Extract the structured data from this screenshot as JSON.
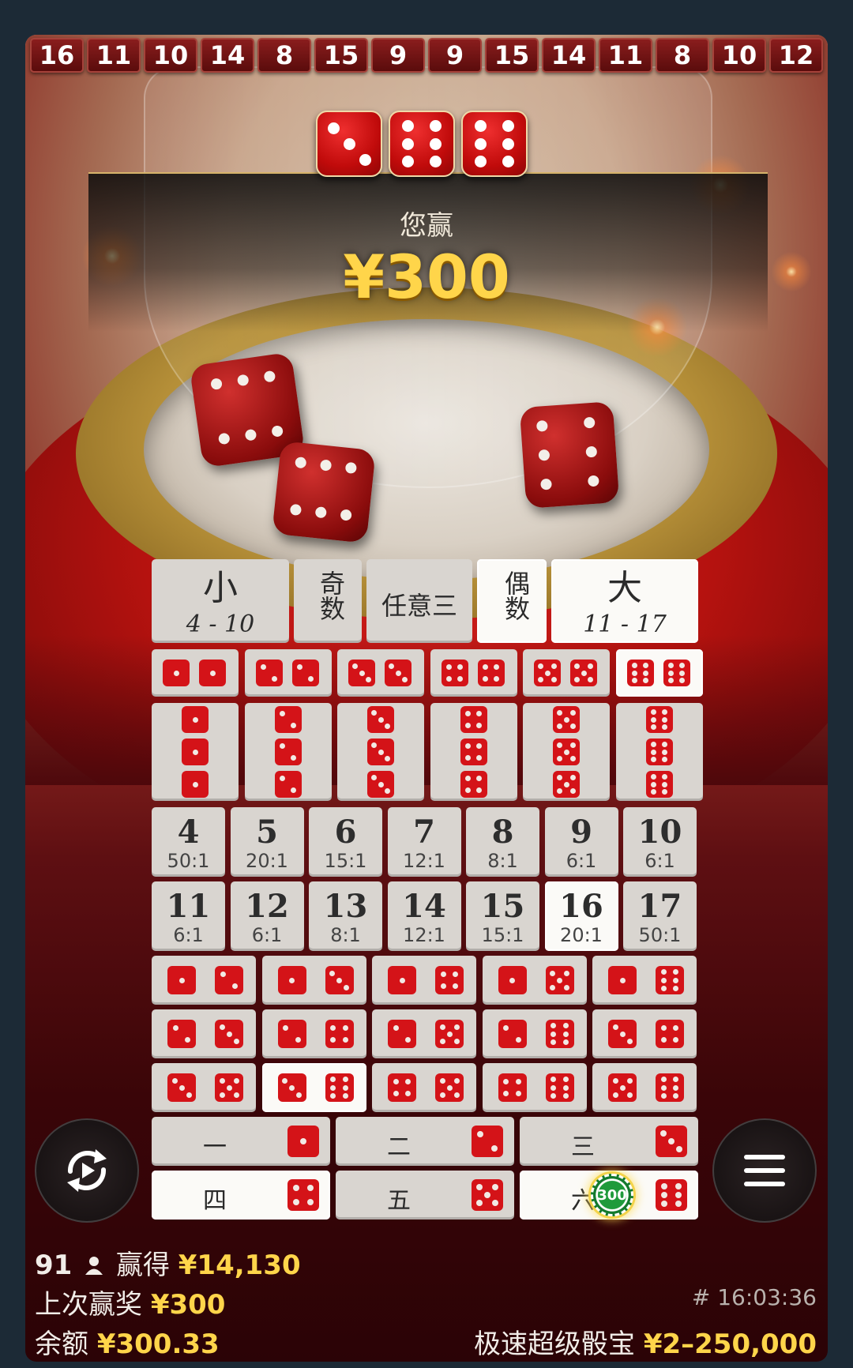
{
  "history": [
    "16",
    "11",
    "10",
    "14",
    "8",
    "15",
    "9",
    "9",
    "15",
    "14",
    "11",
    "8",
    "10",
    "12"
  ],
  "result": {
    "dice": [
      3,
      6,
      6
    ],
    "win_label": "您赢",
    "win_amount": "¥300"
  },
  "bets": {
    "small": {
      "label": "小",
      "range": "4 - 10"
    },
    "odd": "奇数",
    "any_triple": "任意三",
    "even": "偶数",
    "big": {
      "label": "大",
      "range": "11 - 17"
    },
    "totals": [
      {
        "n": "4",
        "odds": "50:1"
      },
      {
        "n": "5",
        "odds": "20:1"
      },
      {
        "n": "6",
        "odds": "15:1"
      },
      {
        "n": "7",
        "odds": "12:1"
      },
      {
        "n": "8",
        "odds": "8:1"
      },
      {
        "n": "9",
        "odds": "6:1"
      },
      {
        "n": "10",
        "odds": "6:1"
      },
      {
        "n": "11",
        "odds": "6:1"
      },
      {
        "n": "12",
        "odds": "6:1"
      },
      {
        "n": "13",
        "odds": "8:1"
      },
      {
        "n": "14",
        "odds": "12:1"
      },
      {
        "n": "15",
        "odds": "15:1"
      },
      {
        "n": "16",
        "odds": "20:1"
      },
      {
        "n": "17",
        "odds": "50:1"
      }
    ],
    "singles": [
      "一",
      "二",
      "三",
      "四",
      "五",
      "六"
    ],
    "chip": "300"
  },
  "footer": {
    "players": "91",
    "won_label": "赢得",
    "won_amount": "¥14,130",
    "last_win_label": "上次赢奖",
    "last_win_amount": "¥300",
    "balance_label": "余额",
    "balance_amount": "¥300.33",
    "round_id": "# 16:03:36",
    "game_name": "极速超级骰宝",
    "limits": "¥2–250,000"
  },
  "icons": {
    "repeat": "repeat-icon",
    "menu": "menu-icon",
    "user": "user-icon"
  },
  "colors": {
    "accent": "#ffd54a",
    "die_red": "#d41318",
    "board": "#d9d5d0"
  }
}
